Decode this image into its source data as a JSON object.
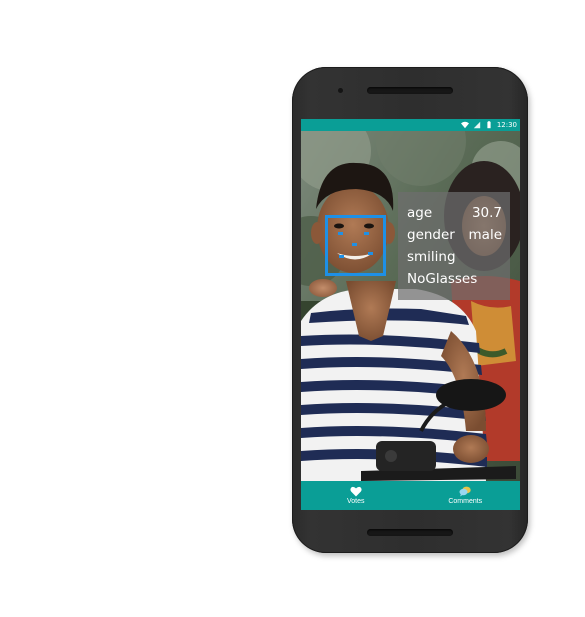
{
  "status_bar": {
    "time": "12:30",
    "icons": [
      "wifi-icon",
      "signal-icon",
      "battery-icon"
    ]
  },
  "face_attributes": {
    "age_label": "age",
    "age_value": "30.7",
    "gender_label": "gender",
    "gender_value": "male",
    "smiling_label": "smiling",
    "glasses_label": "NoGlasses"
  },
  "bottom_nav": {
    "votes_label": "Votes",
    "comments_label": "Comments",
    "votes_icon": "heart-icon",
    "comments_icon": "comment-bubbles-icon"
  },
  "colors": {
    "accent": "#0a9e96",
    "face_box": "#1e90e6"
  }
}
